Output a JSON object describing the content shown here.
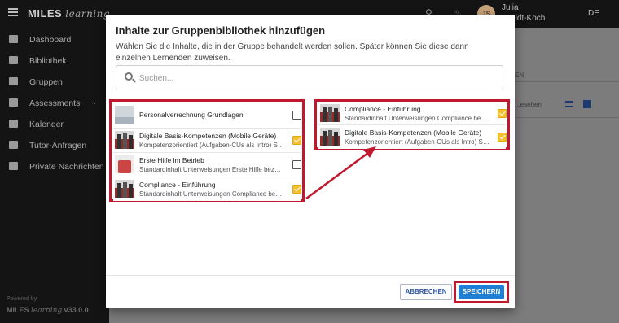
{
  "app": {
    "brand": "MILES",
    "brand_script": "learning",
    "user": {
      "first": "Julia",
      "last": "...midt-Koch",
      "initials": "JS"
    },
    "language": "DE",
    "powered_by": "Powered by",
    "version": "v33.0.0"
  },
  "sidebar": {
    "items": [
      {
        "label": "Dashboard",
        "icon": "dashboard-icon"
      },
      {
        "label": "Bibliothek",
        "icon": "library-icon"
      },
      {
        "label": "Gruppen",
        "icon": "groups-icon"
      },
      {
        "label": "Assessments",
        "icon": "assessment-icon"
      },
      {
        "label": "Kalender",
        "icon": "calendar-icon"
      },
      {
        "label": "Tutor-Anfragen",
        "icon": "tutor-icon"
      },
      {
        "label": "Private Nachrichten",
        "icon": "chat-icon"
      }
    ]
  },
  "background_content": {
    "tab": "EN",
    "sort": "...esehen"
  },
  "modal": {
    "title": "Inhalte zur Gruppenbibliothek hinzufügen",
    "description": "Wählen Sie die Inhalte, die in der Gruppe behandelt werden sollen. Später können Sie diese dann einzelnen Lernenden zuweisen.",
    "search_placeholder": "Suchen...",
    "available_items": [
      {
        "title": "Personalverrechnung Grundlagen",
        "subtitle": "",
        "checked": false,
        "thumb": "paper"
      },
      {
        "title": "Digitale Basis-Kompetenzen (Mobile Geräte)",
        "subtitle": "Kompetenzorientiert (Aufgaben-CUs als Intro) Sam...",
        "checked": true,
        "thumb": "people"
      },
      {
        "title": "Erste Hilfe im Betrieb",
        "subtitle": "Standardinhalt Unterweisungen Erste Hilfe bezeich...",
        "checked": false,
        "thumb": "red"
      },
      {
        "title": "Compliance - Einführung",
        "subtitle": "Standardinhalt Unterweisungen Compliance bezieht...",
        "checked": true,
        "thumb": "people"
      }
    ],
    "selected_items": [
      {
        "title": "Compliance - Einführung",
        "subtitle": "Standardinhalt Unterweisungen Compliance bezieht...",
        "checked": true,
        "thumb": "people"
      },
      {
        "title": "Digitale Basis-Kompetenzen (Mobile Geräte)",
        "subtitle": "Kompetenzorientiert (Aufgaben-CUs als Intro) Sam...",
        "checked": true,
        "thumb": "people"
      }
    ],
    "cancel_label": "ABBRECHEN",
    "save_label": "SPEICHERN"
  },
  "colors": {
    "highlight": "#c0182f",
    "checkbox_on": "#f5c02e",
    "primary": "#1e7fd6"
  }
}
